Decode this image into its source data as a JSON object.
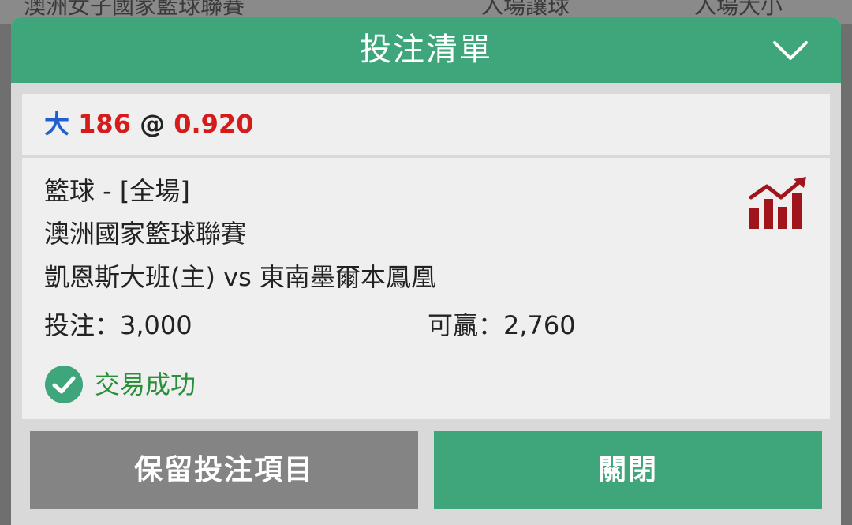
{
  "background": {
    "league_text": "澳洲女子國家籃球聯賽",
    "col1_text": "入場讓球",
    "col2_text": "入場大小"
  },
  "header": {
    "title": "投注清單",
    "toggle_icon": "chevron-down-icon"
  },
  "selection": {
    "pick": "大",
    "line": "186",
    "at": "@",
    "odds": "0.920"
  },
  "bet": {
    "sport_market": "籃球 - [全場]",
    "league": "澳洲國家籃球聯賽",
    "match": "凱恩斯大班(主) vs 東南墨爾本鳳凰",
    "stake_text": "投注：3,000",
    "payout_text": "可贏：2,760",
    "status_text": "交易成功",
    "stats_icon": "stats-chart-icon",
    "status_icon": "check-circle-icon"
  },
  "buttons": {
    "keep_label": "保留投注項目",
    "close_label": "關閉"
  },
  "colors": {
    "header_green": "#3fa57b",
    "button_grey": "#848484",
    "pick_blue": "#1f5fcf",
    "odds_red": "#d61b1b",
    "success_green": "#2a8f3a",
    "icon_dark_red": "#a0141c"
  }
}
